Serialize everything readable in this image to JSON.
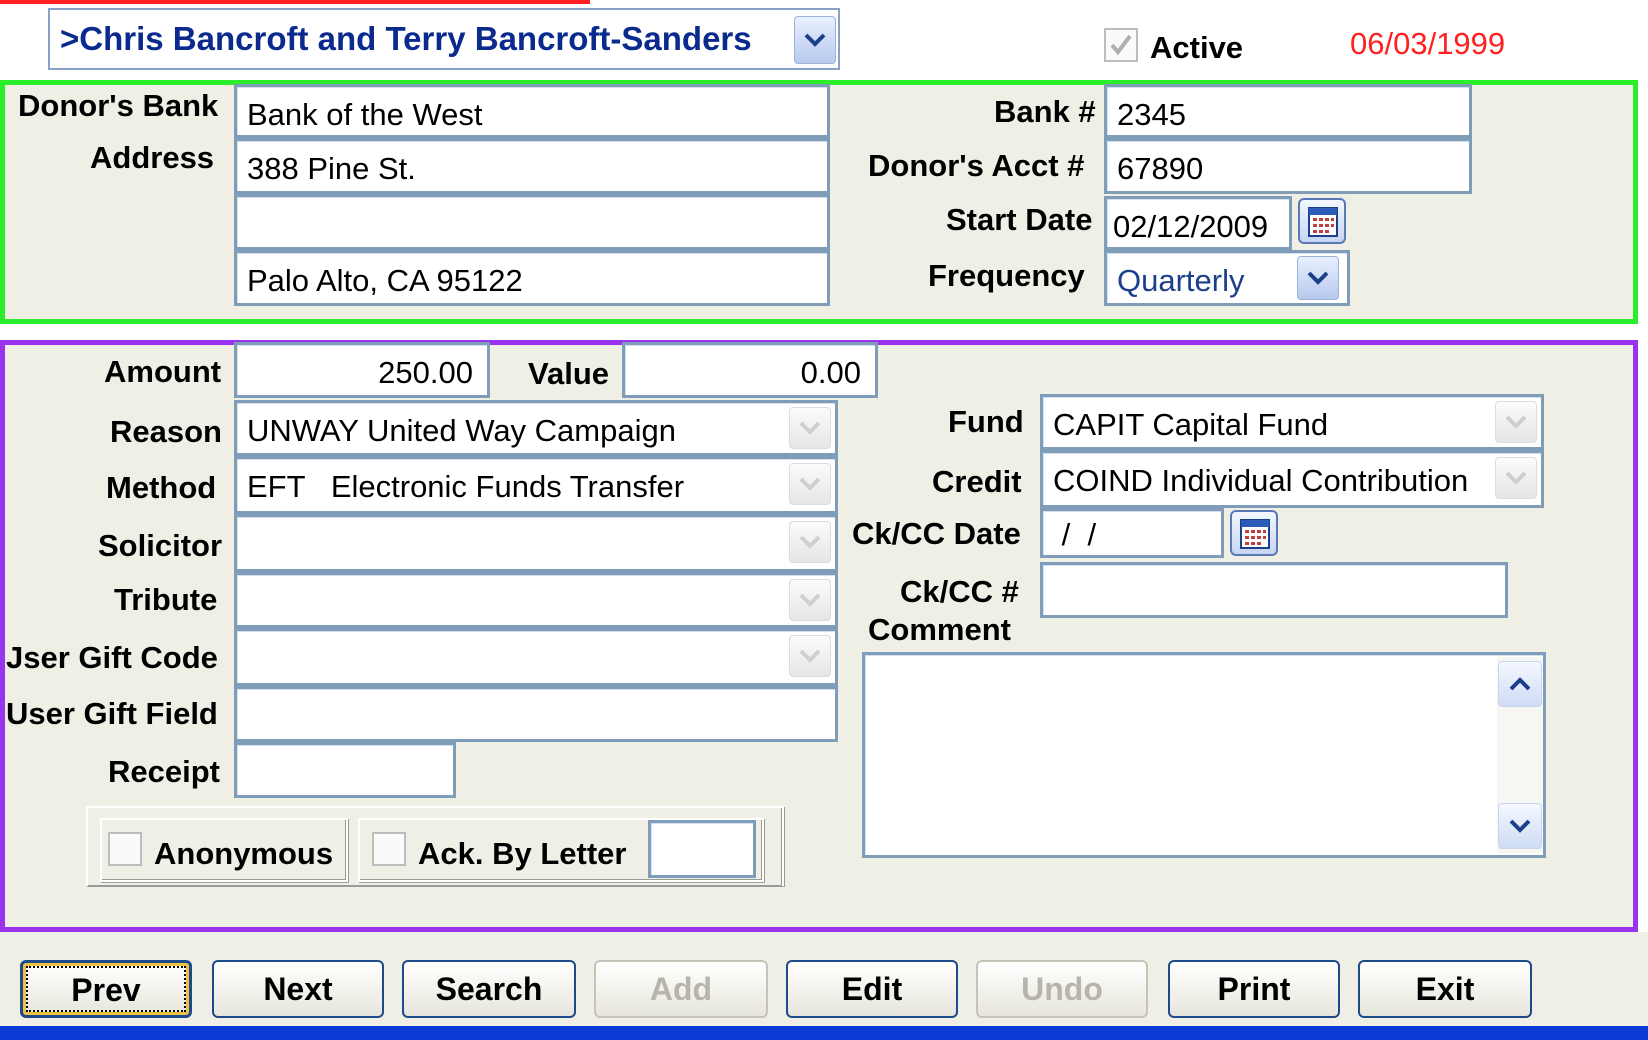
{
  "header": {
    "donor_name": ">Chris Bancroft and Terry Bancroft-Sanders",
    "active_label": "Active",
    "active_checked": true,
    "date": "06/03/1999",
    "date_color": "#ff2020"
  },
  "bank": {
    "donors_bank_label": "Donor's Bank",
    "donors_bank_value": "Bank of the West",
    "address_label": "Address",
    "address_line1": "388 Pine St.",
    "address_line2": "",
    "address_line3": "Palo Alto, CA 95122",
    "bank_num_label": "Bank #",
    "bank_num_value": "2345",
    "acct_label": "Donor's Acct #",
    "acct_value": "67890",
    "start_label": "Start Date",
    "start_value": "02/12/2009",
    "freq_label": "Frequency",
    "freq_value": "Quarterly"
  },
  "gift": {
    "amount_label": "Amount",
    "amount_value": "250.00",
    "value_label": "Value",
    "value_value": "0.00",
    "reason_label": "Reason",
    "reason_value": "UNWAY United Way Campaign",
    "method_label": "Method",
    "method_value": "EFT   Electronic Funds Transfer",
    "solicitor_label": "Solicitor",
    "solicitor_value": "",
    "tribute_label": "Tribute",
    "tribute_value": "",
    "user_gift_code_label": "Jser Gift Code",
    "user_gift_code_value": "",
    "user_gift_field_label": "User Gift Field",
    "user_gift_field_value": "",
    "receipt_label": "Receipt",
    "receipt_value": "",
    "anonymous_label": "Anonymous",
    "ack_label": "Ack. By Letter",
    "ack_value": "",
    "fund_label": "Fund",
    "fund_value": "CAPIT Capital Fund",
    "credit_label": "Credit",
    "credit_value": "COIND Individual Contribution",
    "ckcc_date_label": "Ck/CC Date",
    "ckcc_date_value": " /  /",
    "ckcc_num_label": "Ck/CC #",
    "ckcc_num_value": "",
    "comment_label": "Comment",
    "comment_value": ""
  },
  "buttons": {
    "prev": "Prev",
    "next": "Next",
    "search": "Search",
    "add": "Add",
    "edit": "Edit",
    "undo": "Undo",
    "print": "Print",
    "exit": "Exit"
  },
  "colors": {
    "bank_border": "#29ee29",
    "gift_border": "#9933ee",
    "panel_bg": "#f0efe6",
    "bottom_bar": "#0b3bd6"
  },
  "icons": [
    "chevron-down-icon",
    "calendar-icon",
    "checkmark-icon",
    "chevron-up-icon"
  ]
}
